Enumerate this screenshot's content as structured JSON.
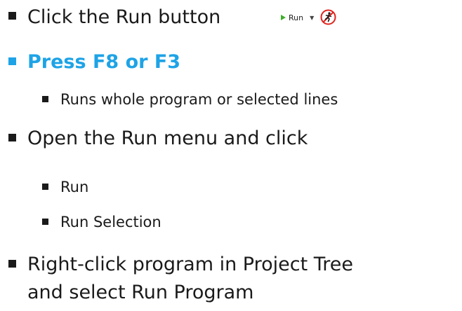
{
  "items": [
    {
      "text": "Click the Run button"
    },
    {
      "text": "Press F8 or F3"
    },
    {
      "text": "Runs whole program or selected lines"
    },
    {
      "text": "Open the Run menu and click"
    },
    {
      "text": "Run"
    },
    {
      "text": "Run Selection"
    },
    {
      "text": "Right-click program in Project Tree"
    },
    {
      "text": "and select Run Program"
    }
  ],
  "run_button": {
    "label": "Run",
    "icon": "play-icon",
    "dropdown_icon": "chevron-down-icon"
  },
  "run_icon": "running-man-icon",
  "colors": {
    "text": "#1a1a1a",
    "accent": "#1ea3e6",
    "play": "#3fae2a",
    "icon_circle": "#e0231d"
  }
}
